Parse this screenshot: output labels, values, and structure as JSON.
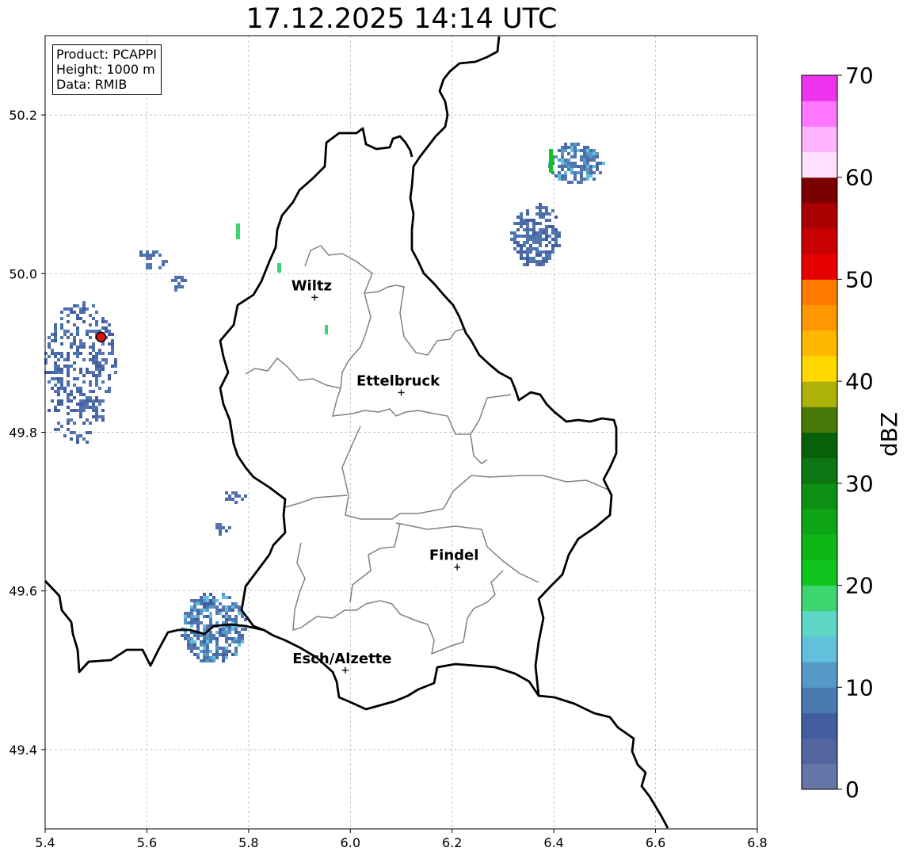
{
  "title": "17.12.2025 14:14 UTC",
  "info_box": {
    "product": "Product: PCAPPI",
    "height": "Height: 1000 m",
    "data": "Data: RMIB"
  },
  "axes": {
    "x_ticks": [
      "5.4",
      "5.6",
      "5.8",
      "6.0",
      "6.2",
      "6.4",
      "6.6",
      "6.8"
    ],
    "y_ticks": [
      "50.2",
      "50.0",
      "49.8",
      "49.6",
      "49.4"
    ],
    "xlim": [
      5.4,
      6.8
    ],
    "ylim": [
      49.3,
      50.3
    ],
    "grid": true
  },
  "cities": [
    {
      "name": "Wiltz",
      "lon": 5.93,
      "lat": 49.97
    },
    {
      "name": "Ettelbruck",
      "lon": 6.1,
      "lat": 49.85
    },
    {
      "name": "Findel",
      "lon": 6.21,
      "lat": 49.63
    },
    {
      "name": "Esch/Alzette",
      "lon": 5.99,
      "lat": 49.5
    }
  ],
  "radar_site": {
    "lon": 5.51,
    "lat": 49.92,
    "color": "#dd1111"
  },
  "colorbar": {
    "label": "dBZ",
    "ticks": [
      "0",
      "10",
      "20",
      "30",
      "40",
      "50",
      "60",
      "70"
    ],
    "range": [
      0,
      70
    ],
    "colors": [
      "#6675a8",
      "#5366a0",
      "#425e9f",
      "#4a79b0",
      "#5898c4",
      "#62c0dc",
      "#5fd6c3",
      "#3dd570",
      "#11c41e",
      "#10b615",
      "#0ea514",
      "#0c8f12",
      "#0c7612",
      "#086009",
      "#487808",
      "#adb208",
      "#ffd800",
      "#ffb800",
      "#ff9800",
      "#ff7b00",
      "#e60000",
      "#c80000",
      "#aa0000",
      "#7a0000",
      "#ffe0ff",
      "#ffb4ff",
      "#ff78ff",
      "#ee33ee"
    ]
  }
}
